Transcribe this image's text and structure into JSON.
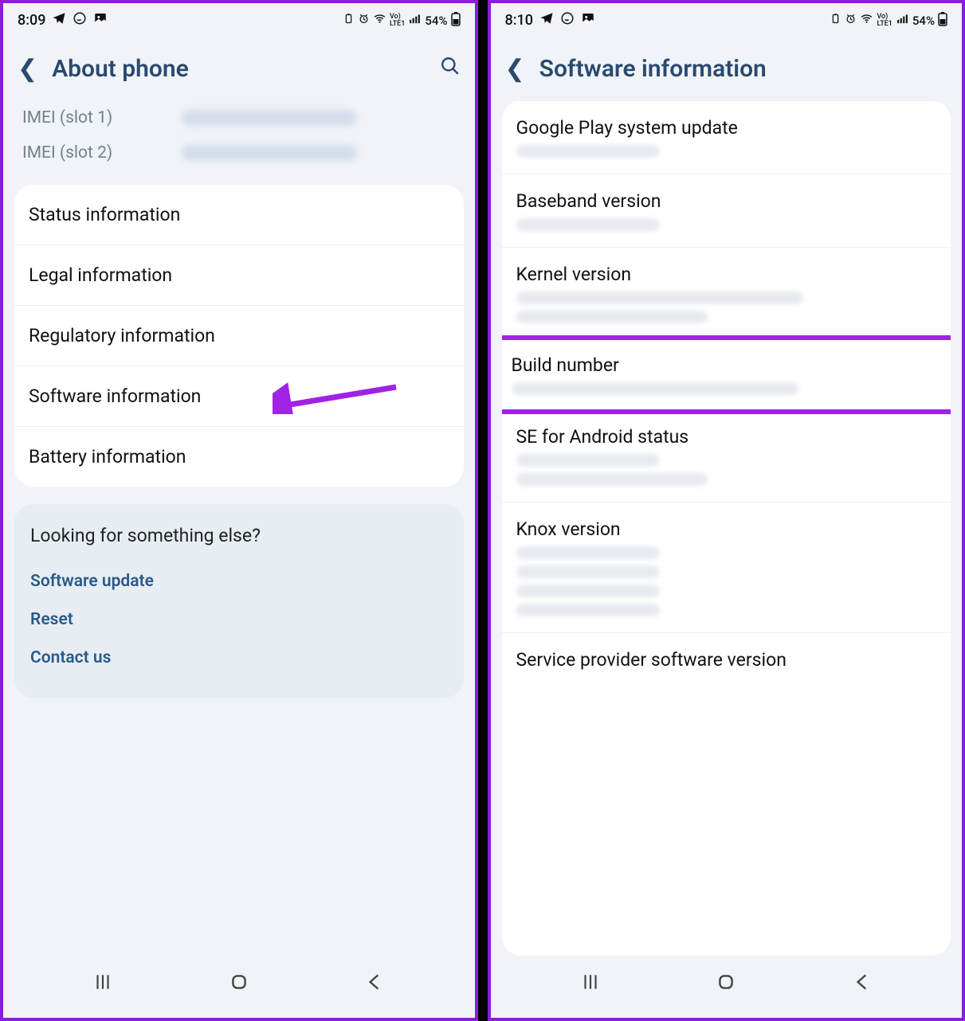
{
  "left": {
    "status": {
      "time": "8:09",
      "battery_pct": "54%",
      "vo_label": "Vo)\nLTE1"
    },
    "header": {
      "title": "About phone"
    },
    "imei": {
      "slot1_label": "IMEI (slot 1)",
      "slot2_label": "IMEI (slot 2)"
    },
    "rows": {
      "status_info": "Status information",
      "legal_info": "Legal information",
      "regulatory_info": "Regulatory information",
      "software_info": "Software information",
      "battery_info": "Battery information"
    },
    "footer": {
      "heading": "Looking for something else?",
      "links": {
        "software_update": "Software update",
        "reset": "Reset",
        "contact_us": "Contact us"
      }
    }
  },
  "right": {
    "status": {
      "time": "8:10",
      "battery_pct": "54%",
      "vo_label": "Vo)\nLTE1"
    },
    "header": {
      "title": "Software information"
    },
    "rows": {
      "gplay": "Google Play system update",
      "baseband": "Baseband version",
      "kernel": "Kernel version",
      "build": "Build number",
      "se_android": "SE for Android status",
      "knox": "Knox version",
      "sp_sw": "Service provider software version"
    }
  },
  "annot": {
    "arrow_color": "#9f22e6",
    "highlight_color": "#9f22e6"
  }
}
